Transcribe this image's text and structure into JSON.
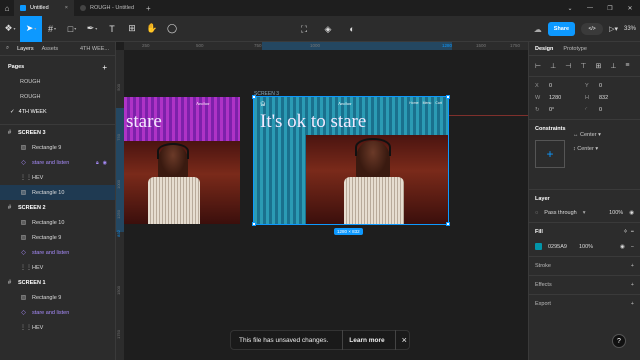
{
  "titlebar": {
    "home_icon": "home-icon",
    "tabs": [
      {
        "label": "Untitled",
        "active": true
      },
      {
        "label": "ROUGH - Untitled",
        "active": false
      }
    ]
  },
  "toolbar": {
    "share_label": "Share",
    "zoom": "33%"
  },
  "left_panel": {
    "tab_layers": "Layers",
    "tab_assets": "Assets",
    "page_selector": "4TH WEE...",
    "pages_heading": "Pages",
    "pages": [
      "ROUGH",
      "ROUGH",
      "4TH WEEK"
    ],
    "layers": [
      {
        "label": "SCREEN 3",
        "type": "frame"
      },
      {
        "label": "Rectangle 9",
        "type": "rect"
      },
      {
        "label": "stare and listen",
        "type": "component"
      },
      {
        "label": "HEV",
        "type": "text"
      },
      {
        "label": "Rectangle 10",
        "type": "rect",
        "selected": true
      },
      {
        "label": "SCREEN 2",
        "type": "frame"
      },
      {
        "label": "Rectangle 10",
        "type": "rect"
      },
      {
        "label": "Rectangle 9",
        "type": "rect"
      },
      {
        "label": "stare and listen",
        "type": "component"
      },
      {
        "label": "HEV",
        "type": "text"
      },
      {
        "label": "SCREEN 1",
        "type": "frame"
      },
      {
        "label": "Rectangle 9",
        "type": "rect"
      },
      {
        "label": "stare and listen",
        "type": "component"
      },
      {
        "label": "HEV",
        "type": "text"
      }
    ]
  },
  "canvas": {
    "ruler_top": [
      "250",
      "500",
      "750",
      "1000",
      "1280",
      "1500",
      "1750"
    ],
    "ruler_left": [
      "500",
      "750",
      "1000",
      "1250",
      "832",
      "1500",
      "1750"
    ],
    "frame_label": "SCREEN 3",
    "frame_a": {
      "headline": "stare",
      "brand": "Anchor"
    },
    "frame_b": {
      "headline": "It's ok to stare",
      "brand": "Anchor",
      "nav": [
        "Home",
        "Menu",
        "Cart"
      ]
    },
    "size_badge": "1280 × 832",
    "toast_message": "This file has unsaved changes.",
    "toast_action": "Learn more"
  },
  "right_panel": {
    "tab_design": "Design",
    "tab_prototype": "Prototype",
    "x": "0",
    "y": "0",
    "w": "1280",
    "h": "832",
    "rotation": "0°",
    "radius": "0",
    "constraints_title": "Constraints",
    "constraint_h": "Center",
    "constraint_v": "Center",
    "layer_title": "Layer",
    "blend": "Pass through",
    "layer_opacity": "100%",
    "fill_title": "Fill",
    "fill_hex": "0295A9",
    "fill_opacity": "100%",
    "fill_color": "#0295a9",
    "stroke_title": "Stroke",
    "effects_title": "Effects",
    "export_title": "Export"
  }
}
